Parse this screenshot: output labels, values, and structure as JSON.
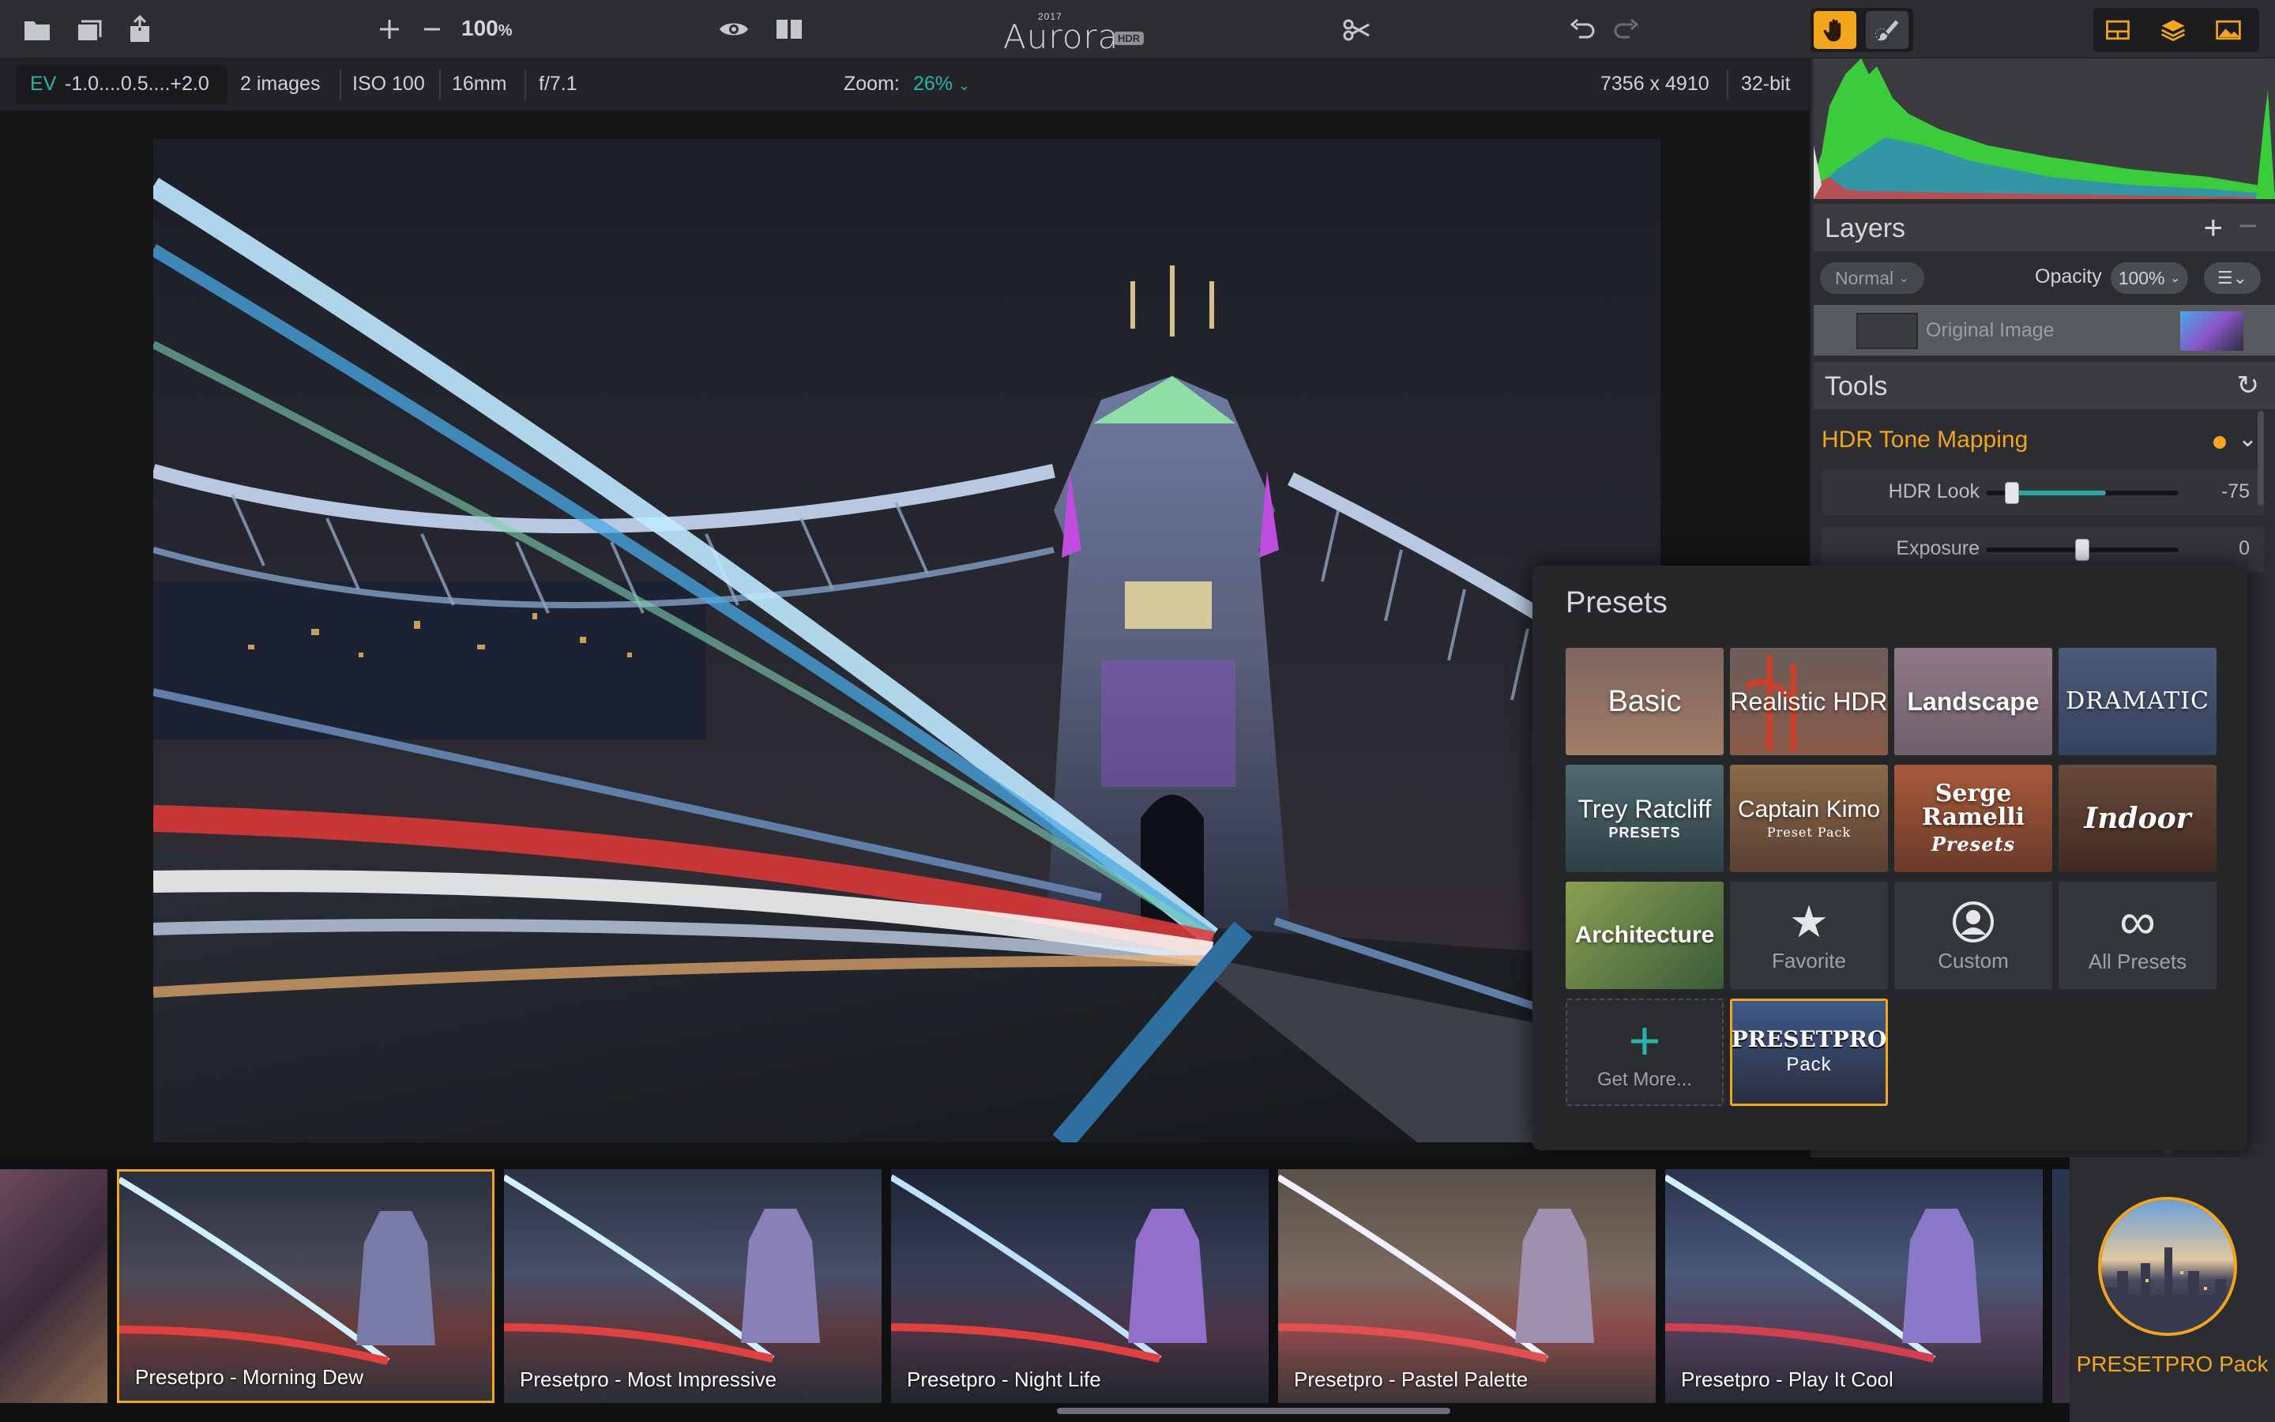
{
  "toolbar": {
    "zoom_percent": "100",
    "zoom_unit": "%",
    "app_name": "Aurora",
    "app_year": "2017",
    "app_badge": "HDR"
  },
  "infobar": {
    "ev_label": "EV",
    "ev_values": "-1.0....0.5....+2.0",
    "images": "2 images",
    "iso": "ISO 100",
    "focal": "16mm",
    "aperture": "f/7.1",
    "zoom_label": "Zoom:",
    "zoom_value": "26%",
    "dimensions": "7356 x 4910",
    "bitdepth": "32-bit"
  },
  "layers": {
    "title": "Layers",
    "blend_mode": "Normal",
    "opacity_label": "Opacity",
    "opacity_value": "100%",
    "layer_name": "Original Image"
  },
  "tools": {
    "title": "Tools",
    "section": "HDR Tone Mapping",
    "sliders": [
      {
        "label": "HDR Look",
        "value": "-75",
        "position": 0.13
      },
      {
        "label": "Exposure",
        "value": "0",
        "position": 0.5
      }
    ]
  },
  "presets": {
    "title": "Presets",
    "tiles": [
      {
        "label": "Basic"
      },
      {
        "label": "Realistic HDR"
      },
      {
        "label": "Landscape"
      },
      {
        "label": "DRAMATIC"
      },
      {
        "label": "Trey Ratcliff",
        "sub": "PRESETS"
      },
      {
        "label": "Captain Kimo",
        "sub": "Preset Pack"
      },
      {
        "label": "Serge Ramelli",
        "sub": "Presets"
      },
      {
        "label": "Indoor"
      },
      {
        "label": "Architecture"
      },
      {
        "label": "Favorite"
      },
      {
        "label": "Custom"
      },
      {
        "label": "All Presets"
      },
      {
        "label": "Get More..."
      },
      {
        "label": "PRESETPRO",
        "sub": "Pack"
      }
    ]
  },
  "filmstrip": {
    "items": [
      {
        "label": "Presetpro - Morning Dew",
        "selected": true
      },
      {
        "label": "Presetpro - Most Impressive"
      },
      {
        "label": "Presetpro - Night Life"
      },
      {
        "label": "Presetpro - Pastel Palette"
      },
      {
        "label": "Presetpro - Play It Cool"
      }
    ],
    "pack_label": "PRESETPRO Pack"
  },
  "colors": {
    "accent": "#f2a51d",
    "teal": "#2aa7a0"
  }
}
